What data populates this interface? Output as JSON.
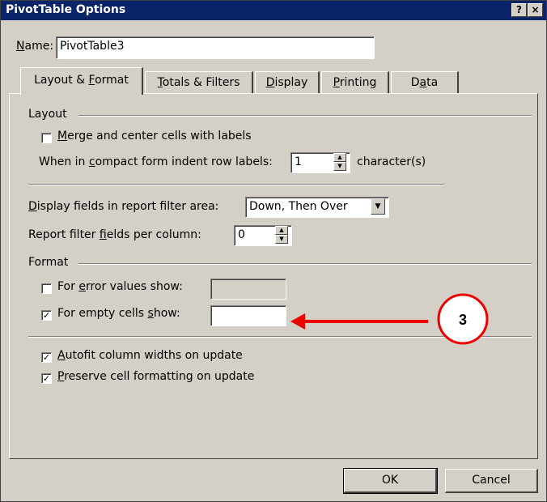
{
  "window": {
    "title": "PivotTable Options",
    "help_label": "?",
    "close_label": "×"
  },
  "name": {
    "label": "Name:",
    "value": "PivotTable3"
  },
  "tabs": [
    {
      "label": "Layout & Format",
      "active": true
    },
    {
      "label": "Totals & Filters",
      "active": false
    },
    {
      "label": "Display",
      "active": false
    },
    {
      "label": "Printing",
      "active": false
    },
    {
      "label": "Data",
      "active": false
    }
  ],
  "layout_group": {
    "heading": "Layout",
    "merge_label": "Merge and center cells with labels",
    "merge_checked": false,
    "indent_label": "When in compact form indent row labels:",
    "indent_value": "1",
    "indent_unit": "character(s)",
    "display_fields_label": "Display fields in report filter area:",
    "display_fields_value": "Down, Then Over",
    "fields_per_column_label": "Report filter fields per column:",
    "fields_per_column_value": "0"
  },
  "format_group": {
    "heading": "Format",
    "error_label": "For error values show:",
    "error_checked": false,
    "error_value": "",
    "empty_label": "For empty cells show:",
    "empty_checked": true,
    "empty_value": "",
    "autofit_label": "Autofit column widths on update",
    "autofit_checked": true,
    "preserve_label": "Preserve cell formatting on update",
    "preserve_checked": true
  },
  "annotation": {
    "callout_number": "3",
    "color": "#ee0000"
  },
  "buttons": {
    "ok": "OK",
    "cancel": "Cancel"
  },
  "colors": {
    "titlebar": "#0a246a",
    "dialog_bg": "#d4d0c8"
  }
}
